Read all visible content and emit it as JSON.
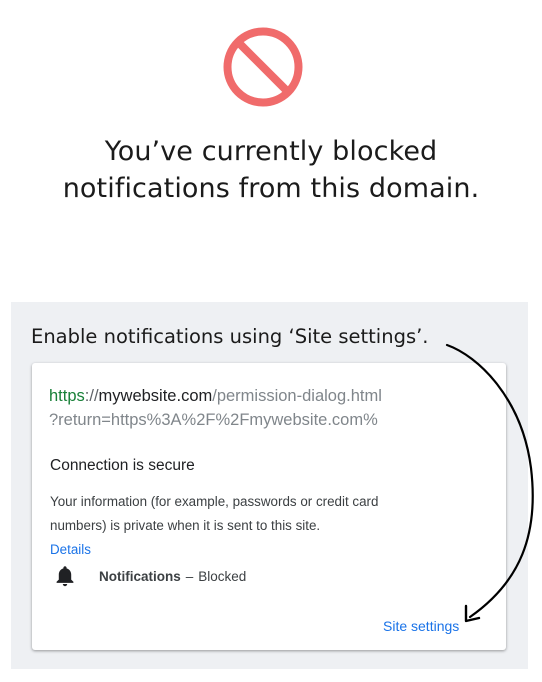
{
  "icons": {
    "blocked": "blocked-icon",
    "bell": "bell-icon",
    "blocked_color": "#f06b6b",
    "link_color": "#1a73e8",
    "secure_scheme_color": "#188038"
  },
  "headline": {
    "line1": "You’ve currently blocked",
    "line2": "notifications from this domain."
  },
  "instruction": "Enable notifications using ‘Site settings’.",
  "dialog": {
    "url": {
      "scheme": "https",
      "separator": "://",
      "host": "mywebsite.com",
      "path": "/permission-dialog.html",
      "query": "?return=https%3A%2F%2Fmywebsite.com%"
    },
    "connection_title": "Connection is secure",
    "info_line1": "Your information (for example, passwords or credit card",
    "info_line2": "numbers) is private when it is sent to this site.",
    "details_link": "Details",
    "permission": {
      "label": "Notifications",
      "separator": "–",
      "status": "Blocked"
    },
    "site_settings_link": "Site settings"
  }
}
